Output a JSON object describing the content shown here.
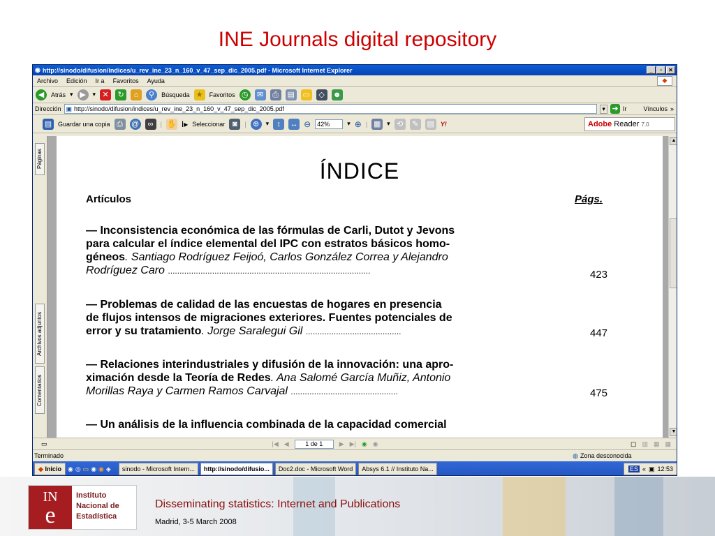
{
  "slide": {
    "title": "INE Journals digital repository",
    "footer_title": "Disseminating statistics: Internet and Publications",
    "footer_subtitle": "Madrid, 3-5 March 2008"
  },
  "logo": {
    "letters_top": "IN",
    "letter_e": "e",
    "line1": "Instituto",
    "line2": "Nacional de",
    "line3": "Estadística"
  },
  "browser": {
    "window_title": "http://sinodo/difusion/indices/u_rev_ine_23_n_160_v_47_sep_dic_2005.pdf - Microsoft Internet Explorer",
    "menu": [
      "Archivo",
      "Edición",
      "Ir a",
      "Favoritos",
      "Ayuda"
    ],
    "toolbar": {
      "back": "Atrás",
      "search": "Búsqueda",
      "favorites": "Favoritos"
    },
    "address_label": "Dirección",
    "address": "http://sinodo/difusion/indices/u_rev_ine_23_n_160_v_47_sep_dic_2005.pdf",
    "go_label": "Ir",
    "links_label": "Vínculos",
    "status_left": "Terminado",
    "status_zone": "Zona desconocida"
  },
  "pdf": {
    "save_copy": "Guardar una copia",
    "select": "Seleccionar",
    "zoom": "42%",
    "page_indicator": "1 de 1",
    "brand_adobe": "Adobe",
    "brand_reader": "Reader",
    "brand_version": "7.0",
    "nav_tabs": {
      "pages": "Páginas",
      "attachments": "Archivos adjuntos",
      "comments": "Comentarios"
    }
  },
  "document": {
    "heading": "ÍNDICE",
    "section_label": "Artículos",
    "pages_label": "Págs.",
    "entries": [
      {
        "title_line1": "— Inconsistencia económica de las fórmulas de Carli, Dutot y Jevons",
        "title_line2": "para calcular el índice elemental del IPC con estratos básicos homo-",
        "title_line3_bold": "géneos",
        "authors_line3": ". Santiago Rodríguez Feijoó, Carlos González Correa y Alejandro",
        "authors_line4": "Rodríguez Caro",
        "dots": ".......................................................................................",
        "page": "423"
      },
      {
        "title_line1": "— Problemas de calidad de las encuestas de hogares en presencia",
        "title_line2": "de flujos intensos de migraciones exteriores. Fuentes potenciales de",
        "title_line3_bold": "error y su tratamiento",
        "authors_line3": ". Jorge Saralegui Gil",
        "dots": ".........................................",
        "page": "447"
      },
      {
        "title_line1": "— Relaciones interindustriales y difusión de la innovación: una apro-",
        "title_line2_bold": "ximación desde la Teoría de Redes",
        "authors_line2": ". Ana Salomé García Muñiz, Antonio",
        "authors_line3": "Morillas Raya y Carmen Ramos Carvajal",
        "dots": "..............................................",
        "page": "475"
      },
      {
        "title_line1": "— Un análisis de la influencia combinada de la capacidad comercial"
      }
    ]
  },
  "taskbar": {
    "start": "Inicio",
    "items": [
      "sinodo - Microsoft Intern...",
      "http://sinodo/difusio...",
      "Doc2.doc - Microsoft Word",
      "Absys 6.1 // Instituto Na..."
    ],
    "lang": "ES",
    "clock": "12:53"
  }
}
